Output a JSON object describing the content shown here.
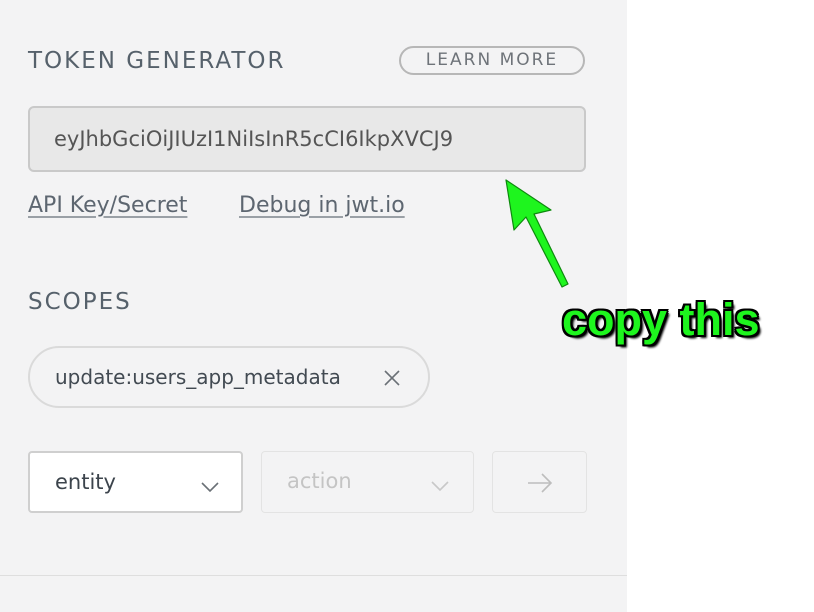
{
  "token_generator": {
    "title": "TOKEN GENERATOR",
    "learn_more_label": "LEARN MORE",
    "token_value": "eyJhbGciOiJIUzI1NiIsInR5cCI6IkpXVCJ9",
    "links": {
      "api_key_label": "API Key/Secret",
      "debug_label": "Debug in jwt.io"
    }
  },
  "scopes": {
    "title": "SCOPES",
    "items": [
      {
        "label": "update:users_app_metadata",
        "remove_icon": "close-icon"
      }
    ]
  },
  "scope_builder": {
    "entity_select": {
      "value": "entity",
      "icon": "chevron-down-icon"
    },
    "action_select": {
      "placeholder": "action",
      "icon": "chevron-down-icon"
    },
    "add_button_icon": "arrow-right-icon"
  },
  "annotation": {
    "text": "copy this",
    "color": "#1ef51e",
    "icon": "arrow-pointer-icon"
  },
  "colors": {
    "panel_background": "#f3f3f4",
    "page_background": "#ffffff",
    "annotation_green": "#1ef51e"
  }
}
